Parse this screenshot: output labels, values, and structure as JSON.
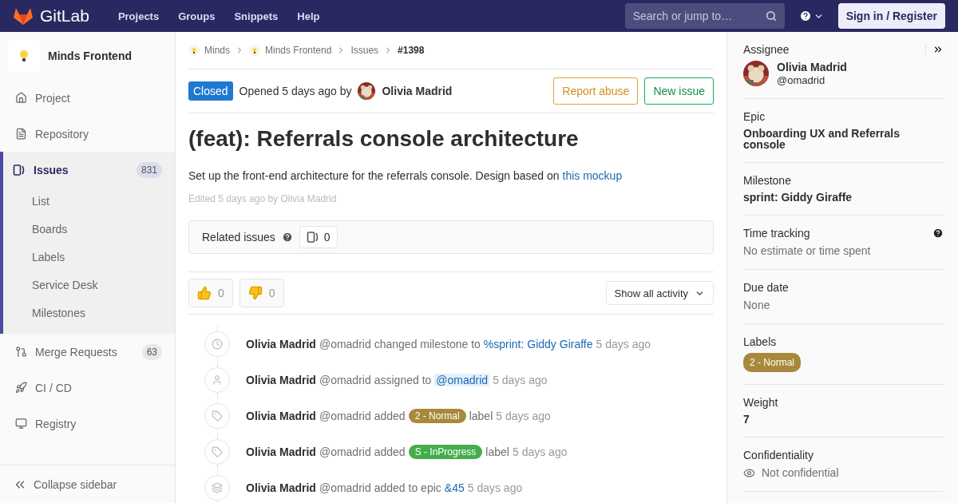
{
  "header": {
    "brand": "GitLab",
    "nav": [
      "Projects",
      "Groups",
      "Snippets",
      "Help"
    ],
    "search": {
      "placeholder": "Search or jump to…"
    },
    "signin": "Sign in / Register"
  },
  "sidebar": {
    "project": "Minds Frontend",
    "items": [
      {
        "label": "Project",
        "selected": false
      },
      {
        "label": "Repository",
        "selected": false
      },
      {
        "label": "Issues",
        "count": "831",
        "selected": true,
        "children": [
          {
            "label": "List"
          },
          {
            "label": "Boards"
          },
          {
            "label": "Labels"
          },
          {
            "label": "Service Desk"
          },
          {
            "label": "Milestones"
          }
        ]
      },
      {
        "label": "Merge Requests",
        "count": "63",
        "selected": false
      },
      {
        "label": "CI / CD",
        "selected": false
      },
      {
        "label": "Registry",
        "selected": false
      }
    ],
    "collapse": "Collapse sidebar"
  },
  "breadcrumbs": [
    {
      "label": "Minds",
      "avatar": true
    },
    {
      "label": "Minds Frontend",
      "avatar": true
    },
    {
      "label": "Issues",
      "avatar": false
    },
    {
      "label": "#1398",
      "avatar": false
    }
  ],
  "issue": {
    "status": "Closed",
    "opened": "Opened 5 days ago by",
    "author": "Olivia Madrid",
    "report": "Report abuse",
    "new": "New issue",
    "title": "(feat): Referrals console architecture",
    "description": "Set up the front-end architecture for the referrals console. Design based on",
    "link": "this mockup",
    "edited": "Edited 5 days ago by Olivia Madrid",
    "related": {
      "label": "Related issues",
      "count": "0"
    },
    "awards": [
      {
        "kind": "up",
        "count": "0"
      },
      {
        "kind": "down",
        "count": "0"
      }
    ],
    "filter": "Show all activity"
  },
  "activity": [
    {
      "author": "Olivia Madrid",
      "user": "@omadrid",
      "parts": [
        {
          "kind": "text",
          "text": "changed milestone to"
        },
        {
          "kind": "link",
          "text": "%sprint: Giddy Giraffe"
        }
      ],
      "time": "5 days ago"
    },
    {
      "author": "Olivia Madrid",
      "user": "@omadrid",
      "parts": [
        {
          "kind": "text",
          "text": "assigned to"
        },
        {
          "kind": "mention",
          "text": "@omadrid"
        }
      ],
      "time": "5 days ago"
    },
    {
      "author": "Olivia Madrid",
      "user": "@omadrid",
      "parts": [
        {
          "kind": "text",
          "text": "added"
        },
        {
          "kind": "label",
          "text": "2 - Normal",
          "color": "#a8893b"
        },
        {
          "kind": "text",
          "text": "label"
        }
      ],
      "time": "5 days ago"
    },
    {
      "author": "Olivia Madrid",
      "user": "@omadrid",
      "parts": [
        {
          "kind": "text",
          "text": "added"
        },
        {
          "kind": "label",
          "text": "S - InProgress",
          "color": "#44ad4d"
        },
        {
          "kind": "text",
          "text": "label"
        }
      ],
      "time": "5 days ago"
    },
    {
      "author": "Olivia Madrid",
      "user": "@omadrid",
      "parts": [
        {
          "kind": "text",
          "text": "added to epic"
        },
        {
          "kind": "link",
          "text": "&45"
        }
      ],
      "time": "5 days ago"
    }
  ],
  "details": {
    "assignee": {
      "title": "Assignee",
      "name": "Olivia Madrid",
      "user": "@omadrid"
    },
    "sections": [
      {
        "kind": "bold",
        "title": "Epic",
        "value": "Onboarding UX and Referrals console"
      },
      {
        "kind": "bold",
        "title": "Milestone",
        "value": "sprint: Giddy Giraffe"
      },
      {
        "kind": "muted",
        "title": "Time tracking",
        "value": "No estimate or time spent",
        "help": true
      },
      {
        "kind": "muted",
        "title": "Due date",
        "value": "None"
      },
      {
        "kind": "label",
        "title": "Labels",
        "value": "2 - Normal",
        "color": "#a8893b"
      },
      {
        "kind": "bold",
        "title": "Weight",
        "value": "7"
      },
      {
        "kind": "eye",
        "title": "Confidentiality",
        "value": "Not confidential"
      }
    ]
  }
}
